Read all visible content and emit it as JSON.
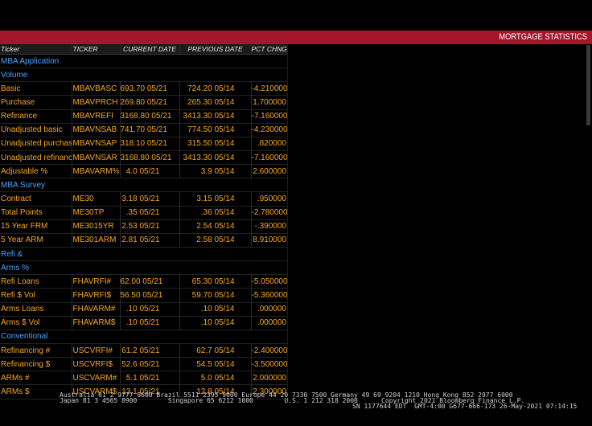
{
  "header": {
    "title": "MORTGAGE STATISTICS"
  },
  "table": {
    "columns": [
      "Ticker",
      "TICKER",
      "CURRENT DATE",
      "PREVIOUS DATE",
      "PCT CHNG"
    ],
    "rows": [
      {
        "type": "section",
        "name": "MBA Application"
      },
      {
        "type": "section",
        "name": "Volume"
      },
      {
        "type": "data",
        "name": "Basic",
        "ticker": "MBAVBASC",
        "current": "693.70 05/21",
        "previous": "724.20 05/14",
        "pct": "-4.210000"
      },
      {
        "type": "data",
        "name": "Purchase",
        "ticker": "MBAVPRCH",
        "current": "269.80 05/21",
        "previous": "265.30 05/14",
        "pct": "1.700000"
      },
      {
        "type": "data",
        "name": "Refinance",
        "ticker": "MBAVREFI",
        "current": "3168.80 05/21",
        "previous": "3413.30 05/14",
        "pct": "-7.160000"
      },
      {
        "type": "data",
        "name": "Unadjusted basic",
        "ticker": "MBAVNSAB",
        "current": "741.70 05/21",
        "previous": "774.50 05/14",
        "pct": "-4.230000"
      },
      {
        "type": "data",
        "name": "Unadjusted purchase",
        "ticker": "MBAVNSAP",
        "current": "318.10 05/21",
        "previous": "315.50 05/14",
        "pct": ".820000"
      },
      {
        "type": "data",
        "name": "Unadjusted refinance",
        "ticker": "MBAVNSAR",
        "current": "3168.80 05/21",
        "previous": "3413.30 05/14",
        "pct": "-7.160000"
      },
      {
        "type": "data",
        "name": "Adjustable %",
        "ticker": "MBAVARM%",
        "current": "4.0 05/21",
        "previous": "3.9 05/14",
        "pct": "2.600000"
      },
      {
        "type": "section",
        "name": "MBA Survey"
      },
      {
        "type": "data",
        "name": "Contract",
        "ticker": "ME30",
        "current": "3.18 05/21",
        "previous": "3.15 05/14",
        "pct": ".950000"
      },
      {
        "type": "data",
        "name": "Total Points",
        "ticker": "ME30TP",
        "current": ".35 05/21",
        "previous": ".36 05/14",
        "pct": "-2.780000"
      },
      {
        "type": "data",
        "name": "15 Year FRM",
        "ticker": "ME3015YR",
        "current": "2.53 05/21",
        "previous": "2.54 05/14",
        "pct": "-.390000"
      },
      {
        "type": "data",
        "name": "5 Year ARM",
        "ticker": "ME301ARM",
        "current": "2.81 05/21",
        "previous": "2.58 05/14",
        "pct": "8.910000"
      },
      {
        "type": "section",
        "name": "Refi &"
      },
      {
        "type": "section",
        "name": "Arms %"
      },
      {
        "type": "data",
        "name": "Refi Loans",
        "ticker": "FHAVRFI#",
        "current": "62.00 05/21",
        "previous": "65.30 05/14",
        "pct": "-5.050000"
      },
      {
        "type": "data",
        "name": "Refi $ Vol",
        "ticker": "FHAVRFI$",
        "current": "56.50 05/21",
        "previous": "59.70 05/14",
        "pct": "-5.360000"
      },
      {
        "type": "data",
        "name": "Arms Loans",
        "ticker": "FHAVARM#",
        "current": ".10 05/21",
        "previous": ".10 05/14",
        "pct": ".000000"
      },
      {
        "type": "data",
        "name": "Arms $ Vol",
        "ticker": "FHAVARM$",
        "current": ".10 05/21",
        "previous": ".10 05/14",
        "pct": ".000000"
      },
      {
        "type": "section",
        "name": "Conventional"
      },
      {
        "type": "data",
        "name": "Refinancing #",
        "ticker": "USCVRFI#",
        "current": "61.2 05/21",
        "previous": "62.7 05/14",
        "pct": "-2.400000"
      },
      {
        "type": "data",
        "name": "Refinancing $",
        "ticker": "USCVRFI$",
        "current": "52.6 05/21",
        "previous": "54.5 05/14",
        "pct": "-3.500000"
      },
      {
        "type": "data",
        "name": "ARMs #",
        "ticker": "USCVARM#",
        "current": "5.1 05/21",
        "previous": "5.0 05/14",
        "pct": "2.000000"
      },
      {
        "type": "data",
        "name": "ARMs $",
        "ticker": "USCVARM$",
        "current": "13.1 05/21",
        "previous": "12.8 05/14",
        "pct": "2.300000"
      }
    ]
  },
  "footer": {
    "line1": "Australia 61 2 9777 8600 Brazil 5511 2395 9000 Europe 44 20 7330 7500 Germany 49 69 9204 1210 Hong Kong 852 2977 6000",
    "line2_left": "Japan 81 3 4565 8900        Singapore 65 6212 1000        U.S. 1 212 318 2000",
    "line2_right": "Copyright 2021 Bloomberg Finance L.P.",
    "line3": "SN 1177644 EDT  GMT-4:00 G677-666-173 26-May-2021 07:14:15"
  },
  "colors": {
    "title_bar": "#a5162b",
    "value_text": "#f5a623",
    "section_text": "#4aa3ff",
    "background": "#000000"
  }
}
